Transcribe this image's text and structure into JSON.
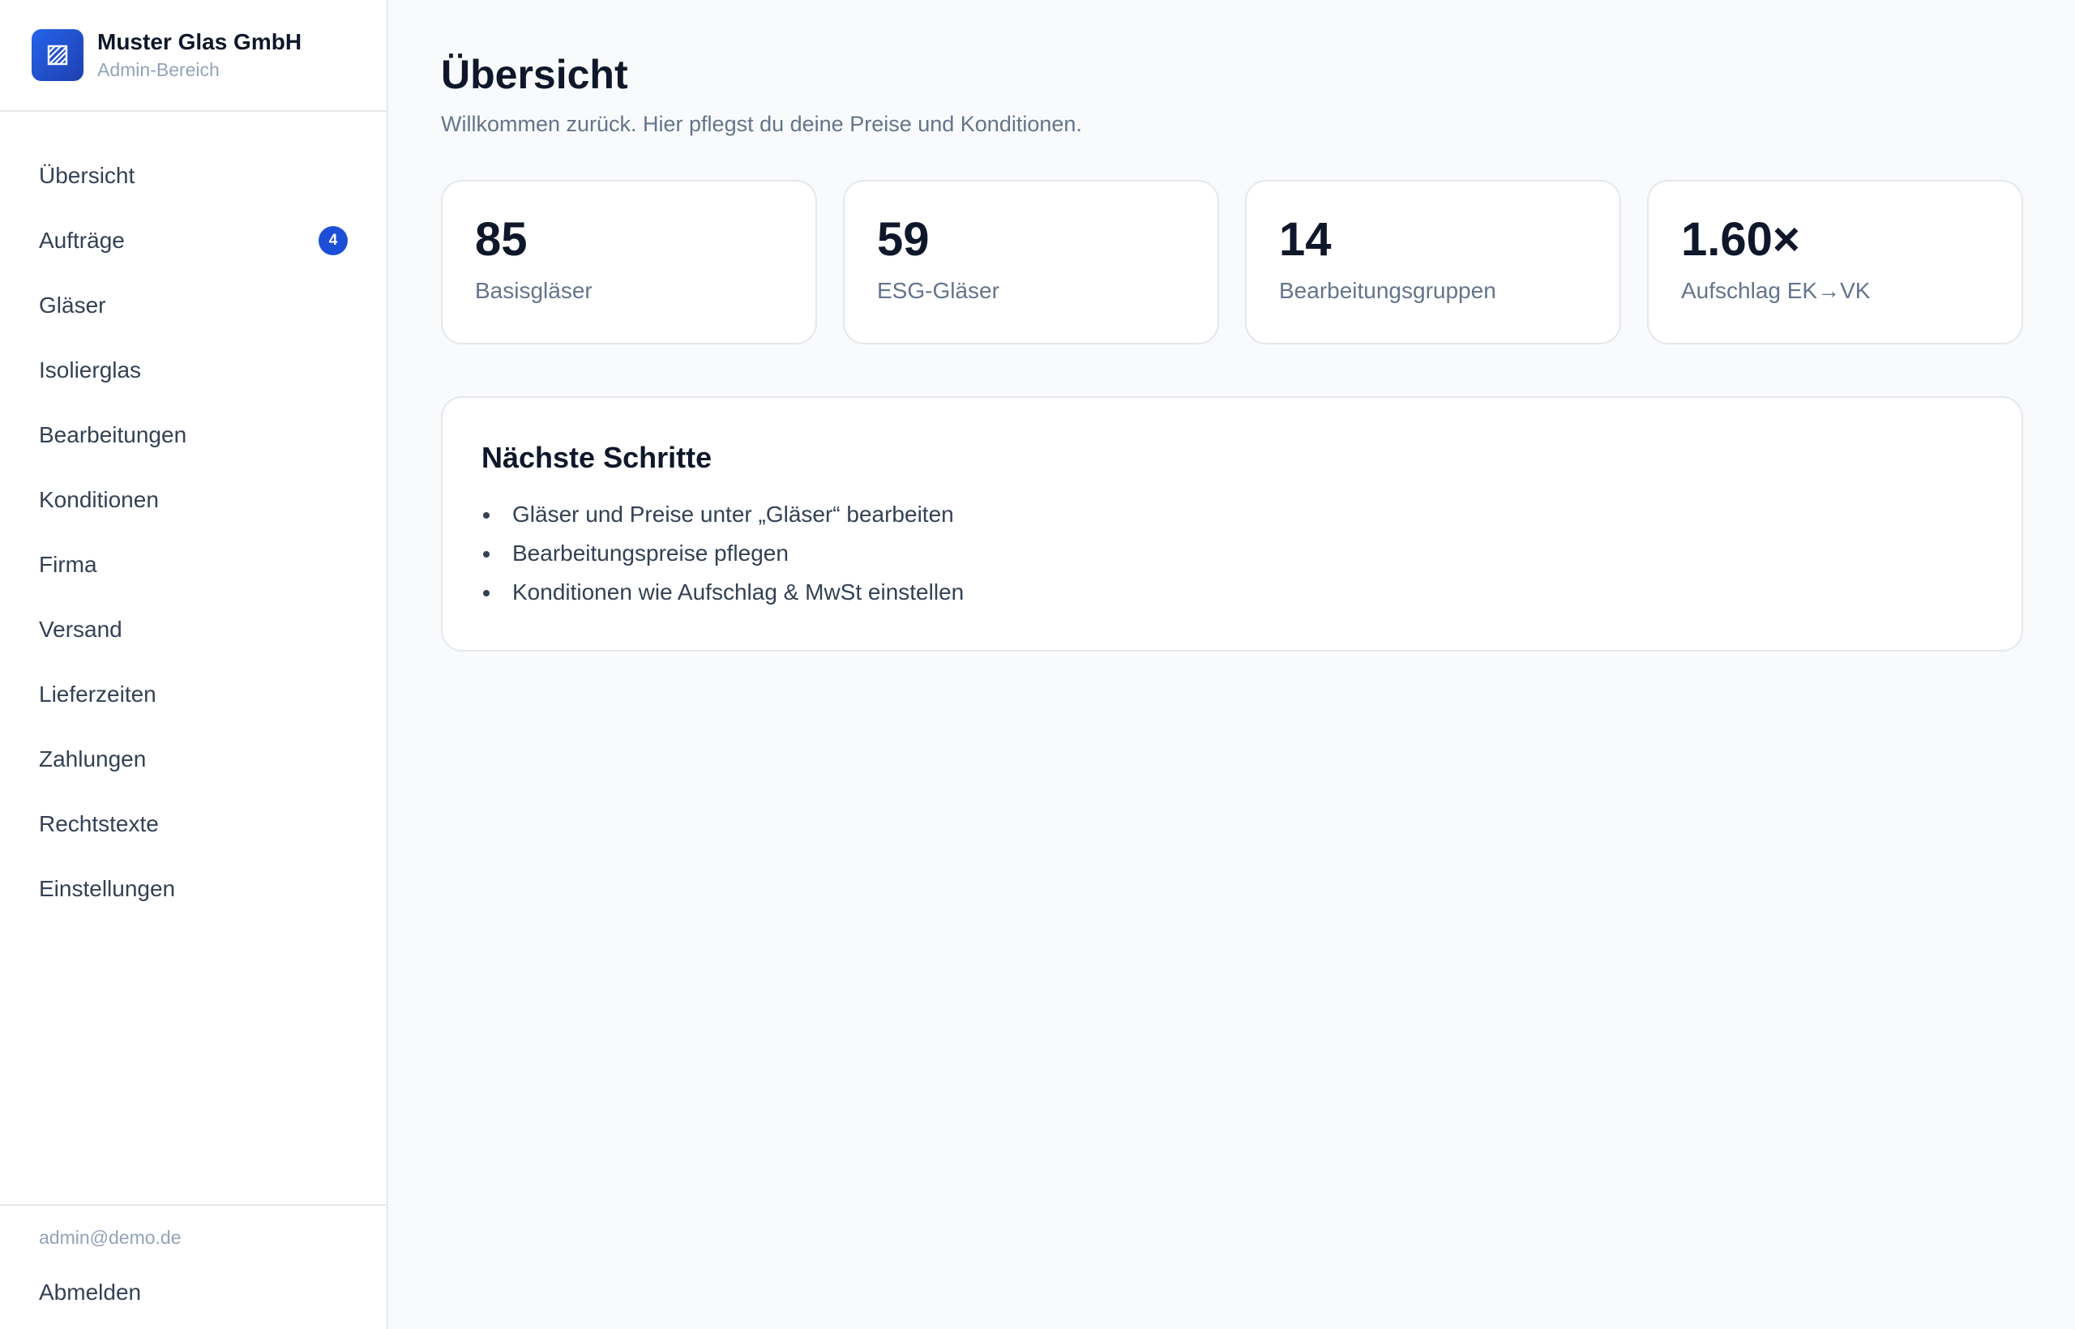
{
  "brand": {
    "name": "Muster Glas GmbH",
    "subtitle": "Admin-Bereich",
    "logo_icon": "glass-icon",
    "accent": "#1d4ed8"
  },
  "nav": {
    "items": [
      {
        "label": "Übersicht"
      },
      {
        "label": "Aufträge",
        "badge": "4"
      },
      {
        "label": "Gläser"
      },
      {
        "label": "Isolierglas"
      },
      {
        "label": "Bearbeitungen"
      },
      {
        "label": "Konditionen"
      },
      {
        "label": "Firma"
      },
      {
        "label": "Versand"
      },
      {
        "label": "Lieferzeiten"
      },
      {
        "label": "Zahlungen"
      },
      {
        "label": "Rechtstexte"
      },
      {
        "label": "Einstellungen"
      }
    ]
  },
  "footer": {
    "email": "admin@demo.de",
    "logout_label": "Abmelden"
  },
  "main": {
    "title": "Übersicht",
    "subtitle": "Willkommen zurück. Hier pflegst du deine Preise und Konditionen.",
    "stats": [
      {
        "value": "85",
        "label": "Basisgläser"
      },
      {
        "value": "59",
        "label": "ESG-Gläser"
      },
      {
        "value": "14",
        "label": "Bearbeitungsgruppen"
      },
      {
        "value": "1.60×",
        "label": "Aufschlag EK→VK"
      }
    ],
    "next_steps": {
      "title": "Nächste Schritte",
      "items": [
        "Gläser und Preise unter „Gläser“ bearbeiten",
        "Bearbeitungspreise pflegen",
        "Konditionen wie Aufschlag & MwSt einstellen"
      ]
    }
  }
}
